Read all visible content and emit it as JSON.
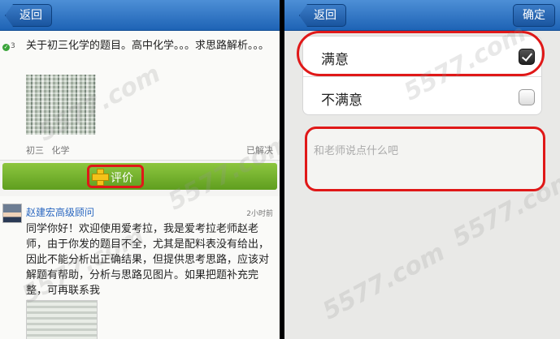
{
  "left_screen": {
    "nav": {
      "back_label": "返回"
    },
    "question": {
      "count": "3",
      "text": "关于初三化学的题目。高中化学。。。求思路解析。。。",
      "grade": "初三",
      "subject": "化学",
      "status": "已解决"
    },
    "rate_button": {
      "label": "评价"
    },
    "answer": {
      "teacher": "赵建宏高级顾问",
      "time": "2小时前",
      "text": "同学你好！欢迎使用爱考拉，我是爱考拉老师赵老师，由于你发的题目不全，尤其是配料表没有给出，因此不能分析出正确结果，但提供思考思路，应该对解题有帮助，分析与思路见图片。如果把题补充完整，可再联系我"
    }
  },
  "right_screen": {
    "nav": {
      "back_label": "返回",
      "confirm_label": "确定"
    },
    "options": [
      {
        "label": "满意",
        "checked": true
      },
      {
        "label": "不满意",
        "checked": false
      }
    ],
    "comment": {
      "placeholder": "和老师说点什么吧"
    }
  },
  "watermark": "5577.com",
  "colors": {
    "nav_blue": "#1e63b5",
    "rate_green": "#6fae2c",
    "highlight_red": "#e01818",
    "teacher_blue": "#2a67c0"
  }
}
